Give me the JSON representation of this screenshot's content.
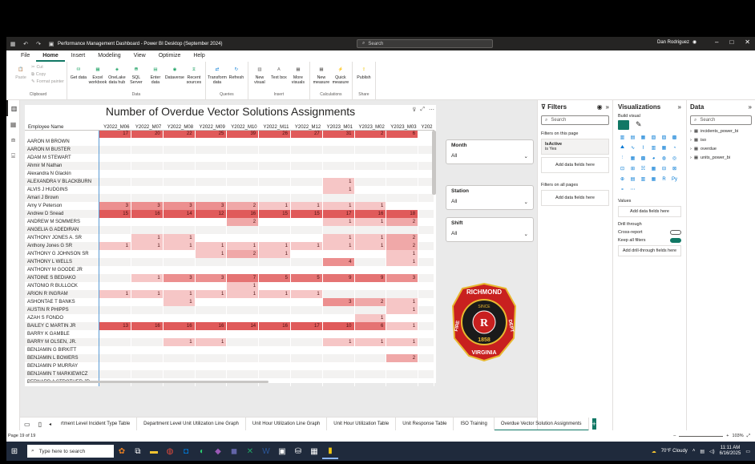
{
  "window": {
    "title": "Performance Management Dashboard - Power BI Desktop (September 2024)",
    "search_placeholder": "Search",
    "user": "Dan Rodriguez"
  },
  "menu": [
    "File",
    "Home",
    "Insert",
    "Modeling",
    "View",
    "Optimize",
    "Help"
  ],
  "ribbon": {
    "clipboard": {
      "paste": "Paste",
      "cut": "Cut",
      "copy": "Copy",
      "format_painter": "Format painter",
      "group": "Clipboard"
    },
    "data": {
      "items": [
        "Get data",
        "Excel workbook",
        "OneLake data hub",
        "SQL Server",
        "Enter data",
        "Dataverse",
        "Recent sources"
      ],
      "group": "Data"
    },
    "queries": {
      "items": [
        "Transform data",
        "Refresh"
      ],
      "group": "Queries"
    },
    "insert": {
      "items": [
        "New visual",
        "Text box",
        "More visuals"
      ],
      "group": "Insert"
    },
    "calculations": {
      "items": [
        "New measure",
        "Quick measure"
      ],
      "group": "Calculations"
    },
    "share": {
      "items": [
        "Publish"
      ],
      "group": "Share"
    }
  },
  "visual": {
    "title": "Number of Overdue Vector Solutions Assignments",
    "name_header": "Employee Name",
    "columns": [
      "Y2022_M06",
      "Y2022_M07",
      "Y2022_M08",
      "Y2022_M09",
      "Y2022_M10",
      "Y2022_M11",
      "Y2022_M12",
      "Y2023_M01",
      "Y2023_M02",
      "Y2023_M03",
      "Y202"
    ],
    "totals": [
      "17",
      "20",
      "22",
      "25",
      "39",
      "26",
      "27",
      "31",
      "2",
      "6",
      ""
    ],
    "rows": [
      {
        "name": "AARON M BROWN",
        "v": [
          "",
          "",
          "",
          "",
          "",
          "",
          "",
          "",
          "",
          "",
          ""
        ]
      },
      {
        "name": "AARON M BUSTER",
        "v": [
          "",
          "",
          "",
          "",
          "",
          "",
          "",
          "",
          "",
          "",
          ""
        ]
      },
      {
        "name": "ADAM M STEWART",
        "v": [
          "",
          "",
          "",
          "",
          "",
          "",
          "",
          "",
          "",
          "",
          ""
        ]
      },
      {
        "name": "Ahmir M Nathan",
        "v": [
          "",
          "",
          "",
          "",
          "",
          "",
          "",
          "",
          "",
          "",
          ""
        ]
      },
      {
        "name": "Alexandra N Glackin",
        "v": [
          "",
          "",
          "",
          "",
          "",
          "",
          "",
          "",
          "",
          "",
          ""
        ]
      },
      {
        "name": "ALEXANDRA V BLACKBURN",
        "v": [
          "",
          "",
          "",
          "",
          "",
          "",
          "",
          "1",
          "",
          "",
          ""
        ]
      },
      {
        "name": "ALVIS J HUDGINS",
        "v": [
          "",
          "",
          "",
          "",
          "",
          "",
          "",
          "1",
          "",
          "",
          ""
        ]
      },
      {
        "name": "Amari J Brown",
        "v": [
          "",
          "",
          "",
          "",
          "",
          "",
          "",
          "",
          "",
          "",
          ""
        ]
      },
      {
        "name": "Amy V Peterson",
        "v": [
          "3",
          "3",
          "3",
          "3",
          "2",
          "1",
          "1",
          "1",
          "1",
          "",
          ""
        ]
      },
      {
        "name": "Andrew D Snead",
        "v": [
          "15",
          "16",
          "14",
          "12",
          "16",
          "15",
          "15",
          "17",
          "16",
          "18",
          ""
        ]
      },
      {
        "name": "ANDREW M SOMMERS",
        "v": [
          "",
          "",
          "",
          "",
          "2",
          "",
          "",
          "1",
          "1",
          "2",
          ""
        ]
      },
      {
        "name": "ANGELIA G ADEDIRAN",
        "v": [
          "",
          "",
          "",
          "",
          "",
          "",
          "",
          "",
          "",
          "",
          ""
        ]
      },
      {
        "name": "ANTHONY JONES A. SR",
        "v": [
          "",
          "1",
          "1",
          "",
          "",
          "",
          "",
          "1",
          "1",
          "2",
          ""
        ]
      },
      {
        "name": "Anthony Jones G SR",
        "v": [
          "1",
          "1",
          "1",
          "1",
          "1",
          "1",
          "1",
          "1",
          "1",
          "2",
          ""
        ]
      },
      {
        "name": "ANTHONY G JOHNSON SR",
        "v": [
          "",
          "",
          "",
          "1",
          "2",
          "1",
          "",
          "",
          "",
          "1",
          ""
        ]
      },
      {
        "name": "ANTHONY L WELLS",
        "v": [
          "",
          "",
          "",
          "",
          "",
          "",
          "",
          "4",
          "",
          "1",
          ""
        ]
      },
      {
        "name": "ANTHONY M GOODE JR",
        "v": [
          "",
          "",
          "",
          "",
          "",
          "",
          "",
          "",
          "",
          "",
          ""
        ]
      },
      {
        "name": "ANTOINE S BEDIAKO",
        "v": [
          "",
          "1",
          "3",
          "3",
          "7",
          "5",
          "5",
          "9",
          "9",
          "3",
          ""
        ]
      },
      {
        "name": "ANTONIO R BULLOCK",
        "v": [
          "",
          "",
          "",
          "",
          "1",
          "",
          "",
          "",
          "",
          "",
          ""
        ]
      },
      {
        "name": "ARION R INGRAM",
        "v": [
          "1",
          "1",
          "1",
          "1",
          "1",
          "1",
          "1",
          "",
          "",
          "",
          ""
        ]
      },
      {
        "name": "ASHONTAE T BANKS",
        "v": [
          "",
          "",
          "1",
          "",
          "",
          "",
          "",
          "3",
          "2",
          "1",
          ""
        ]
      },
      {
        "name": "AUSTIN R PHIPPS",
        "v": [
          "",
          "",
          "",
          "",
          "",
          "",
          "",
          "",
          "",
          "1",
          ""
        ]
      },
      {
        "name": "AZAH S FONDO",
        "v": [
          "",
          "",
          "",
          "",
          "",
          "",
          "",
          "",
          "1",
          "",
          ""
        ]
      },
      {
        "name": "BAILEY C MARTIN JR",
        "v": [
          "13",
          "16",
          "16",
          "16",
          "14",
          "16",
          "17",
          "10",
          "6",
          "1",
          ""
        ]
      },
      {
        "name": "BARRY K GAMBLE",
        "v": [
          "",
          "",
          "",
          "",
          "",
          "",
          "",
          "",
          "",
          "",
          ""
        ]
      },
      {
        "name": "BARRY M OLSEN, JR.",
        "v": [
          "",
          "",
          "1",
          "1",
          "",
          "",
          "",
          "1",
          "1",
          "1",
          ""
        ]
      },
      {
        "name": "BENJAMIN G BIRKITT",
        "v": [
          "",
          "",
          "",
          "",
          "",
          "",
          "",
          "",
          "",
          "",
          ""
        ]
      },
      {
        "name": "BENJAMIN L BOWERS",
        "v": [
          "",
          "",
          "",
          "",
          "",
          "",
          "",
          "",
          "",
          "2",
          ""
        ]
      },
      {
        "name": "BENJAMIN P MURRAY",
        "v": [
          "",
          "",
          "",
          "",
          "",
          "",
          "",
          "",
          "",
          "",
          ""
        ]
      },
      {
        "name": "BENJAMIN T MARKIEWICZ",
        "v": [
          "",
          "",
          "",
          "",
          "",
          "",
          "",
          "",
          "",
          "",
          ""
        ]
      },
      {
        "name": "BERNARD A STROTHER JR",
        "v": [
          "",
          "",
          "",
          "",
          "",
          "",
          "",
          "",
          "",
          "",
          ""
        ]
      }
    ]
  },
  "slicers": [
    {
      "title": "Month",
      "value": "All"
    },
    {
      "title": "Station",
      "value": "All"
    },
    {
      "title": "Shift",
      "value": "All"
    }
  ],
  "logo": {
    "top": "RICHMOND",
    "since": "SINCE",
    "year": "1858",
    "left": "FIRE",
    "right": "DEPT",
    "bottom": "VIRGINIA"
  },
  "filters": {
    "title": "Filters",
    "search": "Search",
    "on_page": "Filters on this page",
    "card_title": "IsActive",
    "card_value": "is Yes",
    "add": "Add data fields here",
    "all_pages": "Filters on all pages",
    "add2": "Add data fields here"
  },
  "visualizations": {
    "title": "Visualizations",
    "build": "Build visual",
    "values": "Values",
    "add_values": "Add data fields here",
    "drill": "Drill through",
    "cross": "Cross-report",
    "cross_state": "Off",
    "keep": "Keep all filters",
    "keep_state": "On",
    "add_drill": "Add drill-through fields here"
  },
  "data_pane": {
    "title": "Data",
    "search": "Search",
    "tables": [
      "incidents_power_bi",
      "iso",
      "overdue",
      "units_power_bi"
    ]
  },
  "tabs": [
    "rtment Level Incident Type Table",
    "Department Level Unit Utilization Line Graph",
    "Unit Hour Utilization Line Graph",
    "Unit Hour Utilization Table",
    "Unit Response Table",
    "ISO Training",
    "Overdue Vector Solution Assignments"
  ],
  "status": {
    "page": "Page 19 of 19",
    "zoom": "103%"
  },
  "taskbar": {
    "search": "Type here to search",
    "weather": "70°F  Cloudy",
    "time": "11:11 AM",
    "date": "6/16/2025"
  }
}
